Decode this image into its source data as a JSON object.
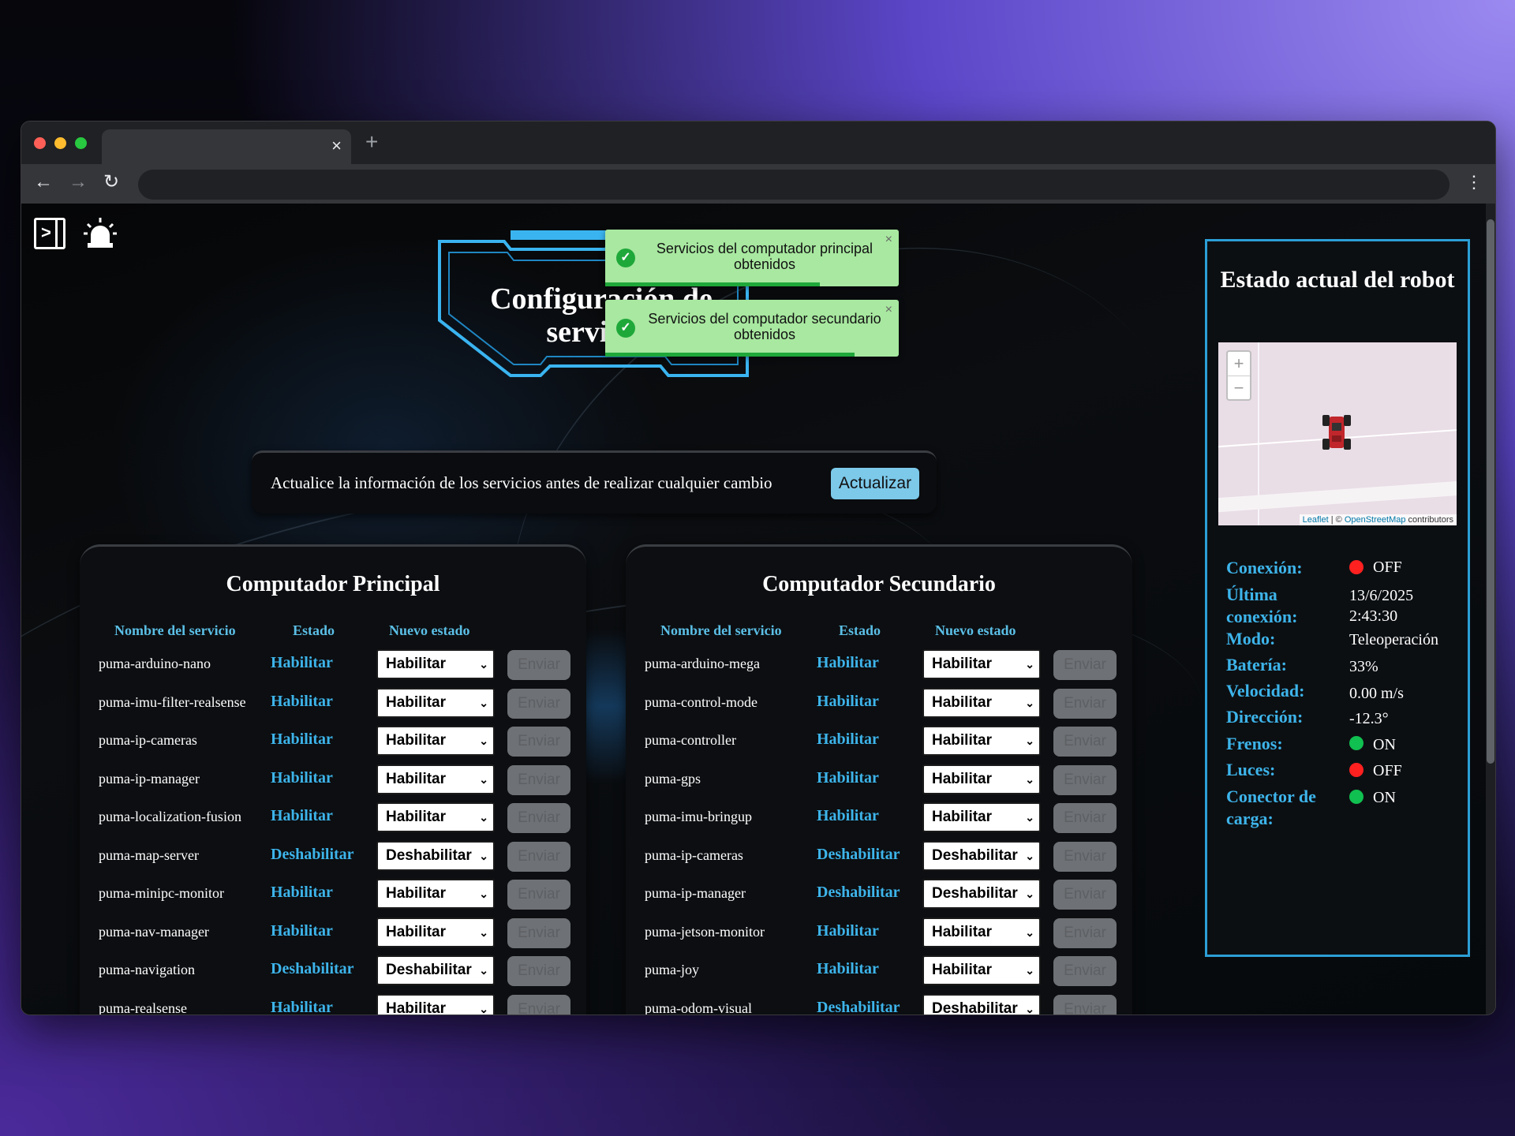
{
  "browser": {
    "tab_close": "×",
    "new_tab": "+",
    "back": "←",
    "forward": "→",
    "reload": "↻",
    "menu": "⋮"
  },
  "page": {
    "title": "Configuración de servicios",
    "toasts": [
      {
        "message": "Servicios del computador principal obtenidos",
        "close": "×",
        "progress": 0.73
      },
      {
        "message": "Servicios del computador secundario obtenidos",
        "close": "×",
        "progress": 0.85
      }
    ],
    "info": {
      "text": "Actualice la información de los servicios antes de realizar cualquier cambio",
      "button": "Actualizar"
    },
    "columns": {
      "name": "Nombre del servicio",
      "state": "Estado",
      "new_state": "Nuevo estado"
    },
    "send_label": "Enviar",
    "primary": {
      "title": "Computador Principal",
      "rows": [
        {
          "name": "puma-arduino-nano",
          "state": "Habilitar",
          "new": "Habilitar"
        },
        {
          "name": "puma-imu-filter-realsense",
          "state": "Habilitar",
          "new": "Habilitar"
        },
        {
          "name": "puma-ip-cameras",
          "state": "Habilitar",
          "new": "Habilitar"
        },
        {
          "name": "puma-ip-manager",
          "state": "Habilitar",
          "new": "Habilitar"
        },
        {
          "name": "puma-localization-fusion",
          "state": "Habilitar",
          "new": "Habilitar"
        },
        {
          "name": "puma-map-server",
          "state": "Deshabilitar",
          "new": "Deshabilitar"
        },
        {
          "name": "puma-minipc-monitor",
          "state": "Habilitar",
          "new": "Habilitar"
        },
        {
          "name": "puma-nav-manager",
          "state": "Habilitar",
          "new": "Habilitar"
        },
        {
          "name": "puma-navigation",
          "state": "Deshabilitar",
          "new": "Deshabilitar"
        },
        {
          "name": "puma-realsense",
          "state": "Habilitar",
          "new": "Habilitar"
        }
      ]
    },
    "secondary": {
      "title": "Computador Secundario",
      "rows": [
        {
          "name": "puma-arduino-mega",
          "state": "Habilitar",
          "new": "Habilitar"
        },
        {
          "name": "puma-control-mode",
          "state": "Habilitar",
          "new": "Habilitar"
        },
        {
          "name": "puma-controller",
          "state": "Habilitar",
          "new": "Habilitar"
        },
        {
          "name": "puma-gps",
          "state": "Habilitar",
          "new": "Habilitar"
        },
        {
          "name": "puma-imu-bringup",
          "state": "Habilitar",
          "new": "Habilitar"
        },
        {
          "name": "puma-ip-cameras",
          "state": "Deshabilitar",
          "new": "Deshabilitar"
        },
        {
          "name": "puma-ip-manager",
          "state": "Deshabilitar",
          "new": "Deshabilitar"
        },
        {
          "name": "puma-jetson-monitor",
          "state": "Habilitar",
          "new": "Habilitar"
        },
        {
          "name": "puma-joy",
          "state": "Habilitar",
          "new": "Habilitar"
        },
        {
          "name": "puma-odom-visual",
          "state": "Deshabilitar",
          "new": "Deshabilitar"
        }
      ]
    }
  },
  "robot_status": {
    "title": "Estado actual del robot",
    "map": {
      "zoom_in": "+",
      "zoom_out": "−",
      "leaflet": "Leaflet",
      "separator": " | © ",
      "osm": "OpenStreetMap",
      "contrib": " contributors"
    },
    "items": [
      {
        "label": "Conexión:",
        "value": "OFF",
        "led": "red"
      },
      {
        "label": "Última conexión:",
        "value": "13/6/2025 2:43:30"
      },
      {
        "label": "Modo:",
        "value": "Teleoperación"
      },
      {
        "label": "Batería:",
        "value": "33%"
      },
      {
        "label": "Velocidad:",
        "value": "0.00 m/s"
      },
      {
        "label": "Dirección:",
        "value": "-12.3°"
      },
      {
        "label": "Frenos:",
        "value": "ON",
        "led": "green"
      },
      {
        "label": "Luces:",
        "value": "OFF",
        "led": "red"
      },
      {
        "label": "Conector de carga:",
        "value": "ON",
        "led": "green"
      }
    ]
  },
  "colors": {
    "accent": "#3db4ea",
    "frame": "#2c9fd6",
    "toast_bg": "#a8e8a0",
    "toast_ok": "#1fa83a"
  }
}
